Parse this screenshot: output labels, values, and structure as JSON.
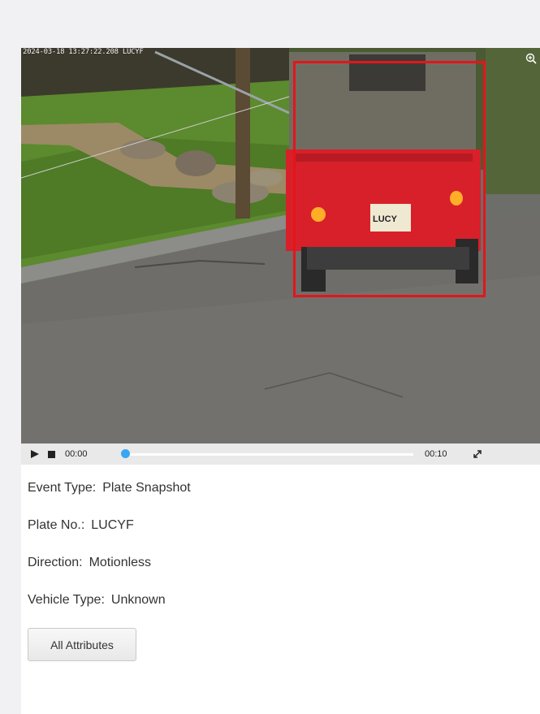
{
  "video": {
    "timestamp_overlay": "2024-03-18 13:27:22.208 LUCYF",
    "plate_on_vehicle": "LUCYF",
    "plate_on_vehicle_visible": "LUCY",
    "bbox_color": "#e6141b",
    "zoom_icon": "zoom-in-icon"
  },
  "player": {
    "current_time": "00:00",
    "end_time": "00:10",
    "progress": 0,
    "accent": "#39a6f2"
  },
  "info": {
    "event_type_label": "Event Type:",
    "event_type_value": "Plate Snapshot",
    "plate_label": "Plate No.:",
    "plate_value": "LUCYF",
    "direction_label": "Direction:",
    "direction_value": "Motionless",
    "vehicle_type_label": "Vehicle Type:",
    "vehicle_type_value": "Unknown"
  },
  "actions": {
    "all_attributes_label": "All Attributes"
  }
}
